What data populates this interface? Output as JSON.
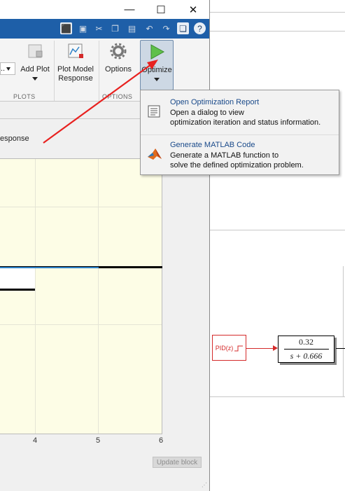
{
  "window": {
    "minimize": "—",
    "maximize": "☐",
    "close": "✕"
  },
  "ribbon": {
    "partial_dropdown": "..",
    "add_plot_label": "Add Plot",
    "plot_model_label": "Plot Model",
    "plot_model_label2": "Response",
    "options_label": "Options",
    "optimize_label": "Optimize",
    "plots_section": "PLOTS",
    "options_section": "OPTIONS"
  },
  "plot": {
    "title_partial": "esponse",
    "x_ticks": [
      "4",
      "5",
      "6"
    ]
  },
  "update_button": "Update block",
  "menu": {
    "items": [
      {
        "title": "Open Optimization Report",
        "desc_line1": "Open a dialog to view",
        "desc_line2": "optimization iteration and status information.",
        "icon": "report-icon"
      },
      {
        "title": "Generate MATLAB Code",
        "desc_line1": "Generate a MATLAB function to",
        "desc_line2": "solve the defined optimization problem.",
        "icon": "matlab-icon"
      }
    ]
  },
  "model": {
    "pid_label": "PID(z)",
    "tf_num": "0.32",
    "tf_den": "s + 0.666"
  },
  "colors": {
    "ribbon_bar": "#1e5fa8",
    "plot_bg": "#fdfde6",
    "pid_red": "#d42a2a",
    "arrow_red": "#e8211f",
    "menu_title": "#1a4a8a"
  }
}
